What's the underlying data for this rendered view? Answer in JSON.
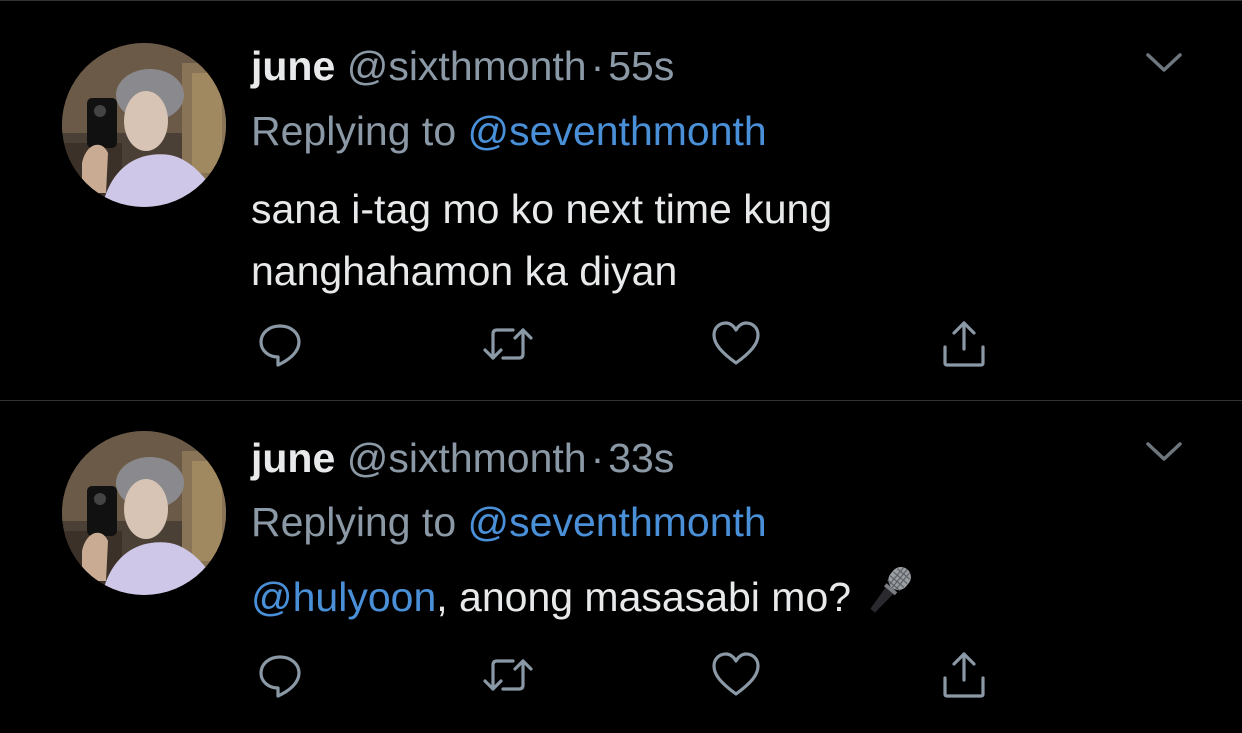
{
  "tweets": [
    {
      "name": "june",
      "handle": "@sixthmonth",
      "separator": "·",
      "time": "55s",
      "replying_prefix": "Replying to",
      "replying_to": "@seventhmonth",
      "text": "sana i-tag mo ko next time kung nanghahamon ka diyan"
    },
    {
      "name": "june",
      "handle": "@sixthmonth",
      "separator": "·",
      "time": "33s",
      "replying_prefix": "Replying to",
      "replying_to": "@seventhmonth",
      "text_mention": "@hulyoon",
      "text_rest": ", anong masasabi mo?",
      "emoji": "microphone-icon"
    }
  ],
  "colors": {
    "background": "#000000",
    "primary_text": "#e7e9ea",
    "secondary_text": "#8b98a5",
    "link": "#4a90d9",
    "divider": "#2f3336"
  },
  "icons": [
    "reply-icon",
    "retweet-icon",
    "like-icon",
    "share-icon",
    "chevron-down-icon"
  ]
}
